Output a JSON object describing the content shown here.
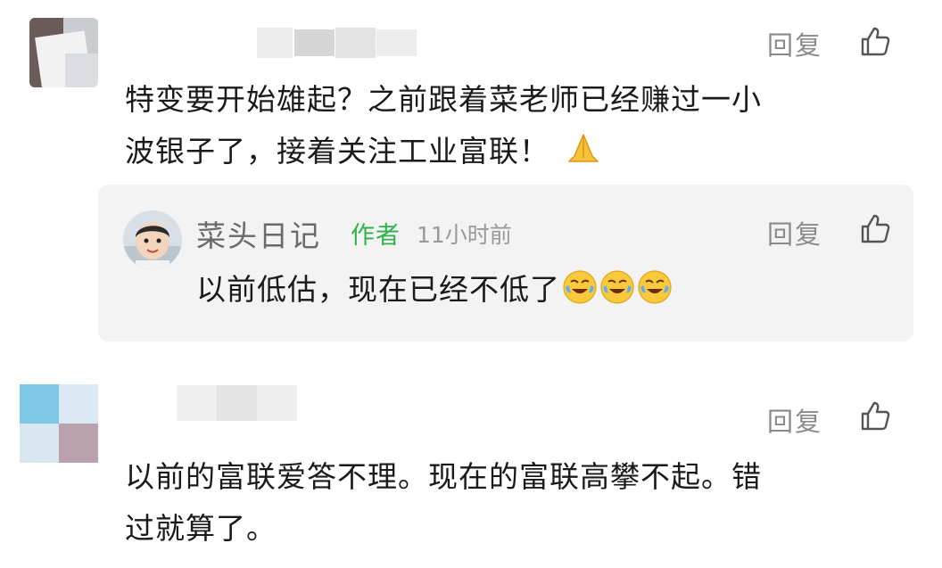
{
  "comments": [
    {
      "text_line1": "特变要开始雄起？之前跟着菜老师已经赚过一小",
      "text_line2": "波银子了，接着关注工业富联！",
      "reply_label": "回复",
      "reply": {
        "author": "菜头日记",
        "author_tag": "作者",
        "time": "11小时前",
        "text": "以前低估，现在已经不低了",
        "reply_label": "回复"
      }
    },
    {
      "text_line1": "以前的富联爱答不理。现在的富联高攀不起。错",
      "text_line2": "过就算了。",
      "reply_label": "回复"
    }
  ],
  "icons": {
    "like": "thumbs-up-outline-icon",
    "pray": "folded-hands-emoji",
    "cry": "crying-laughing-face-emoji"
  },
  "colors": {
    "author_tag": "#2eb34a",
    "reply_bg": "#f3f3f3",
    "muted_text": "#8a8a8a"
  }
}
